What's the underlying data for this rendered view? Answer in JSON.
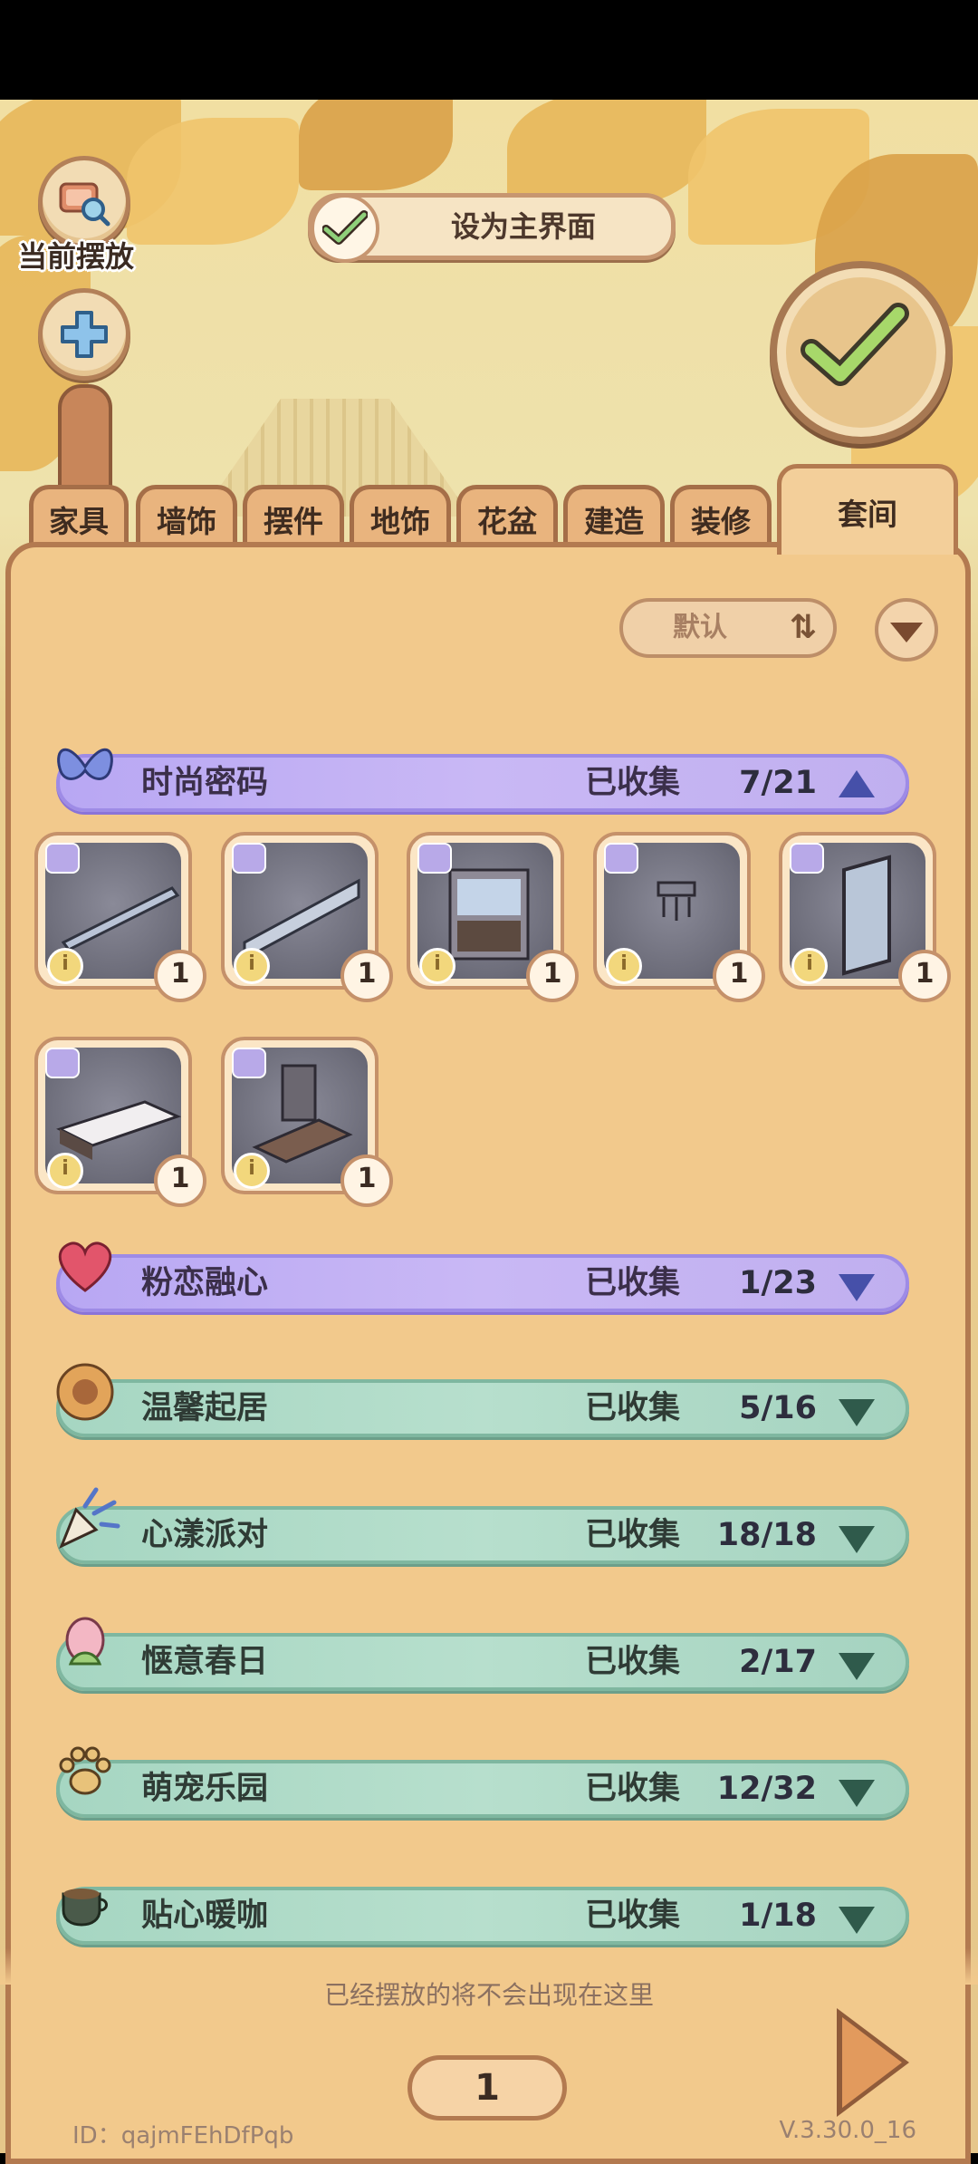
{
  "top_left": {
    "current_label": "当前摆放"
  },
  "set_main_button": {
    "label": "设为主界面"
  },
  "tabs": [
    {
      "label": "家具"
    },
    {
      "label": "墙饰"
    },
    {
      "label": "摆件"
    },
    {
      "label": "地饰"
    },
    {
      "label": "花盆"
    },
    {
      "label": "建造"
    },
    {
      "label": "装修"
    },
    {
      "label": "套间"
    }
  ],
  "active_tab": "套间",
  "sort": {
    "label": "默认"
  },
  "sets": [
    {
      "name": "时尚密码",
      "collected_label": "已收集",
      "count": "7/21",
      "expanded": true,
      "theme": "purple"
    },
    {
      "name": "粉恋融心",
      "collected_label": "已收集",
      "count": "1/23",
      "expanded": false,
      "theme": "purple"
    },
    {
      "name": "温馨起居",
      "collected_label": "已收集",
      "count": "5/16",
      "expanded": false,
      "theme": "green"
    },
    {
      "name": "心漾派对",
      "collected_label": "已收集",
      "count": "18/18",
      "expanded": false,
      "theme": "green"
    },
    {
      "name": "惬意春日",
      "collected_label": "已收集",
      "count": "2/17",
      "expanded": false,
      "theme": "green"
    },
    {
      "name": "萌宠乐园",
      "collected_label": "已收集",
      "count": "12/32",
      "expanded": false,
      "theme": "green"
    },
    {
      "name": "贴心暖咖",
      "collected_label": "已收集",
      "count": "1/18",
      "expanded": false,
      "theme": "green"
    }
  ],
  "items": [
    {
      "qty": "1",
      "info": "i"
    },
    {
      "qty": "1",
      "info": "i"
    },
    {
      "qty": "1",
      "info": "i"
    },
    {
      "qty": "1",
      "info": "i"
    },
    {
      "qty": "1",
      "info": "i"
    },
    {
      "qty": "1",
      "info": "i"
    },
    {
      "qty": "1",
      "info": "i"
    }
  ],
  "footer": {
    "note": "已经摆放的将不会出现在这里",
    "page": "1",
    "id_text": "ID：qajmFEhDfPqb",
    "version": "V.3.30.0_16"
  },
  "colors": {
    "panel": "#f2c98c",
    "purple_header": "#c4b3f4",
    "green_header": "#b1dbc9",
    "border": "#b37a50"
  }
}
